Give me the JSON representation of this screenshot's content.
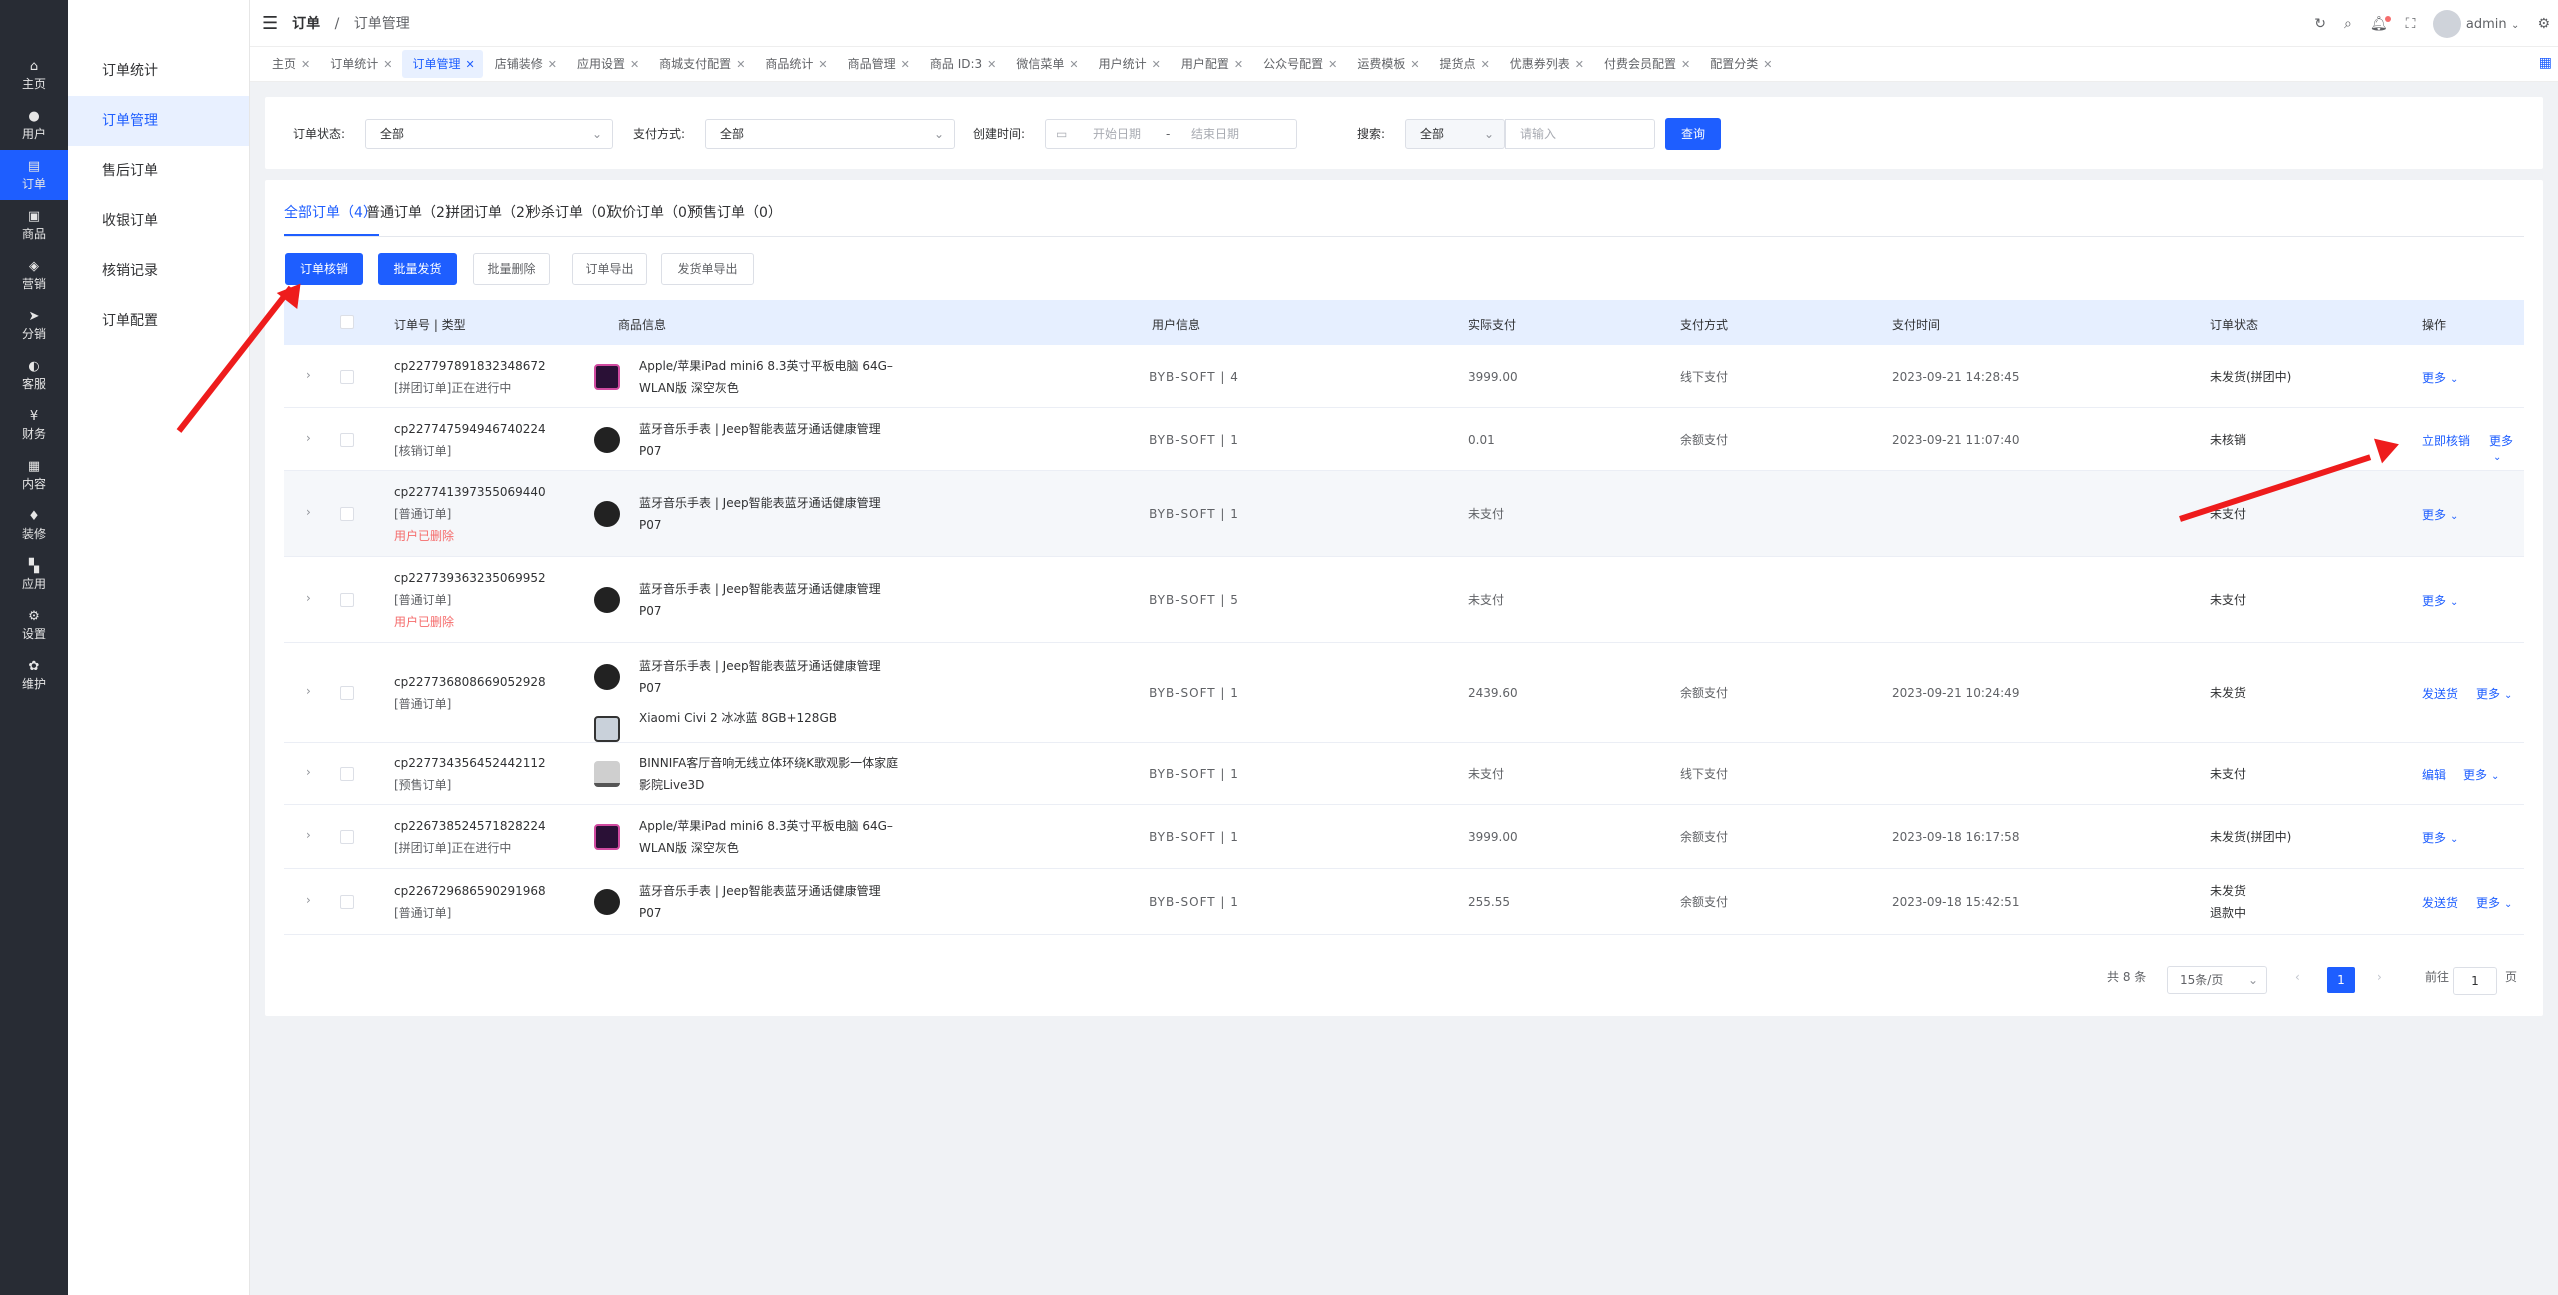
{
  "nav": [
    {
      "icon": "home-icon",
      "glyph": "⌂",
      "label": "主页"
    },
    {
      "icon": "user-icon",
      "glyph": "●",
      "label": "用户"
    },
    {
      "icon": "order-icon",
      "glyph": "▤",
      "label": "订单",
      "active": true
    },
    {
      "icon": "goods-icon",
      "glyph": "▣",
      "label": "商品"
    },
    {
      "icon": "marketing-icon",
      "glyph": "◈",
      "label": "营销"
    },
    {
      "icon": "distribution-icon",
      "glyph": "➤",
      "label": "分销"
    },
    {
      "icon": "service-icon",
      "glyph": "◐",
      "label": "客服"
    },
    {
      "icon": "finance-icon",
      "glyph": "¥",
      "label": "财务"
    },
    {
      "icon": "content-icon",
      "glyph": "▦",
      "label": "内容"
    },
    {
      "icon": "decorate-icon",
      "glyph": "♦",
      "label": "装修"
    },
    {
      "icon": "app-icon",
      "glyph": "▚",
      "label": "应用"
    },
    {
      "icon": "settings-icon",
      "glyph": "⚙",
      "label": "设置"
    },
    {
      "icon": "maintain-icon",
      "glyph": "✿",
      "label": "维护"
    }
  ],
  "submenu": [
    "订单统计",
    "订单管理",
    "售后订单",
    "收银订单",
    "核销记录",
    "订单配置"
  ],
  "header": {
    "crumb_root": "订单",
    "crumb_sep": "/",
    "crumb_page": "订单管理",
    "user": "admin"
  },
  "tabs": [
    "主页",
    "订单统计",
    "订单管理",
    "店铺装修",
    "应用设置",
    "商城支付配置",
    "商品统计",
    "商品管理",
    "商品 ID:3",
    "微信菜单",
    "用户统计",
    "用户配置",
    "公众号配置",
    "运费模板",
    "提货点",
    "优惠券列表",
    "付费会员配置",
    "配置分类"
  ],
  "filter": {
    "status_label": "订单状态:",
    "status_value": "全部",
    "pay_label": "支付方式:",
    "pay_value": "全部",
    "time_label": "创建时间:",
    "start_ph": "开始日期",
    "range_sep": "-",
    "end_ph": "结束日期",
    "search_label": "搜索:",
    "search_type": "全部",
    "search_ph": "请输入",
    "query_btn": "查询"
  },
  "order_tabs": [
    "全部订单（4）",
    "普通订单（2）",
    "拼团订单（2）",
    "秒杀订单（0）",
    "砍价订单（0）",
    "预售订单（0）"
  ],
  "actions": [
    "订单核销",
    "批量发货",
    "批量删除",
    "订单导出",
    "发货单导出"
  ],
  "columns": [
    "订单号 | 类型",
    "商品信息",
    "用户信息",
    "实际支付",
    "支付方式",
    "支付时间",
    "订单状态",
    "操作"
  ],
  "rows": [
    {
      "no": "cp227797891832348672",
      "type": "[拼团订单]正在进行中",
      "deleted": "",
      "goods": [
        {
          "img": "ipad",
          "name": "Apple/苹果iPad mini6 8.3英寸平板电脑 64G–WLAN版 深空灰色"
        }
      ],
      "user": "BYB-SOFT | 4",
      "pay": "3999.00",
      "method": "线下支付",
      "time": "2023-09-21 14:28:45",
      "status": "未发货(拼团中)",
      "status2": "",
      "op1": "",
      "more": "更多"
    },
    {
      "no": "cp227747594946740224",
      "type": "[核销订单]",
      "deleted": "",
      "goods": [
        {
          "img": "watch",
          "name": "蓝牙音乐手表 | Jeep智能表蓝牙通话健康管理 P07"
        }
      ],
      "user": "BYB-SOFT | 1",
      "pay": "0.01",
      "method": "余额支付",
      "time": "2023-09-21 11:07:40",
      "status": "未核销",
      "status2": "",
      "op1": "立即核销",
      "more": "更多"
    },
    {
      "no": "cp227741397355069440",
      "type": "[普通订单]",
      "deleted": "用户已删除",
      "goods": [
        {
          "img": "watch",
          "name": "蓝牙音乐手表 | Jeep智能表蓝牙通话健康管理 P07"
        }
      ],
      "user": "BYB-SOFT | 1",
      "pay": "未支付",
      "method": "",
      "time": "",
      "status": "未支付",
      "status2": "",
      "op1": "",
      "more": "更多"
    },
    {
      "no": "cp227739363235069952",
      "type": "[普通订单]",
      "deleted": "用户已删除",
      "goods": [
        {
          "img": "watch",
          "name": "蓝牙音乐手表 | Jeep智能表蓝牙通话健康管理 P07"
        }
      ],
      "user": "BYB-SOFT | 5",
      "pay": "未支付",
      "method": "",
      "time": "",
      "status": "未支付",
      "status2": "",
      "op1": "",
      "more": "更多"
    },
    {
      "no": "cp227736808669052928",
      "type": "[普通订单]",
      "deleted": "",
      "goods": [
        {
          "img": "watch",
          "name": "蓝牙音乐手表 | Jeep智能表蓝牙通话健康管理 P07"
        },
        {
          "img": "phone",
          "name": "Xiaomi Civi 2 冰冰蓝 8GB+128GB"
        }
      ],
      "user": "BYB-SOFT | 1",
      "pay": "2439.60",
      "method": "余额支付",
      "time": "2023-09-21 10:24:49",
      "status": "未发货",
      "status2": "",
      "op1": "发送货",
      "more": "更多"
    },
    {
      "no": "cp227734356452442112",
      "type": "[预售订单]",
      "deleted": "",
      "goods": [
        {
          "img": "speaker",
          "name": "BINNIFA客厅音响无线立体环绕K歌观影一体家庭影院Live3D"
        }
      ],
      "user": "BYB-SOFT | 1",
      "pay": "未支付",
      "method": "线下支付",
      "time": "",
      "status": "未支付",
      "status2": "",
      "op1": "编辑",
      "more": "更多"
    },
    {
      "no": "cp226738524571828224",
      "type": "[拼团订单]正在进行中",
      "deleted": "",
      "goods": [
        {
          "img": "ipad",
          "name": "Apple/苹果iPad mini6 8.3英寸平板电脑 64G–WLAN版 深空灰色"
        }
      ],
      "user": "BYB-SOFT | 1",
      "pay": "3999.00",
      "method": "余额支付",
      "time": "2023-09-18 16:17:58",
      "status": "未发货(拼团中)",
      "status2": "",
      "op1": "",
      "more": "更多"
    },
    {
      "no": "cp226729686590291968",
      "type": "[普通订单]",
      "deleted": "",
      "goods": [
        {
          "img": "watch",
          "name": "蓝牙音乐手表 | Jeep智能表蓝牙通话健康管理 P07"
        }
      ],
      "user": "BYB-SOFT | 1",
      "pay": "255.55",
      "method": "余额支付",
      "time": "2023-09-18 15:42:51",
      "status": "未发货",
      "status2": "退款中",
      "op1": "发送货",
      "more": "更多"
    }
  ],
  "pager": {
    "total": "共 8 条",
    "size": "15条/页",
    "page": "1",
    "goto_label": "前往",
    "goto_value": "1",
    "goto_unit": "页"
  },
  "colors": {
    "primary": "#1e5eff",
    "sidebar": "#282c34",
    "annotation_arrow": "#ee1c1c"
  }
}
